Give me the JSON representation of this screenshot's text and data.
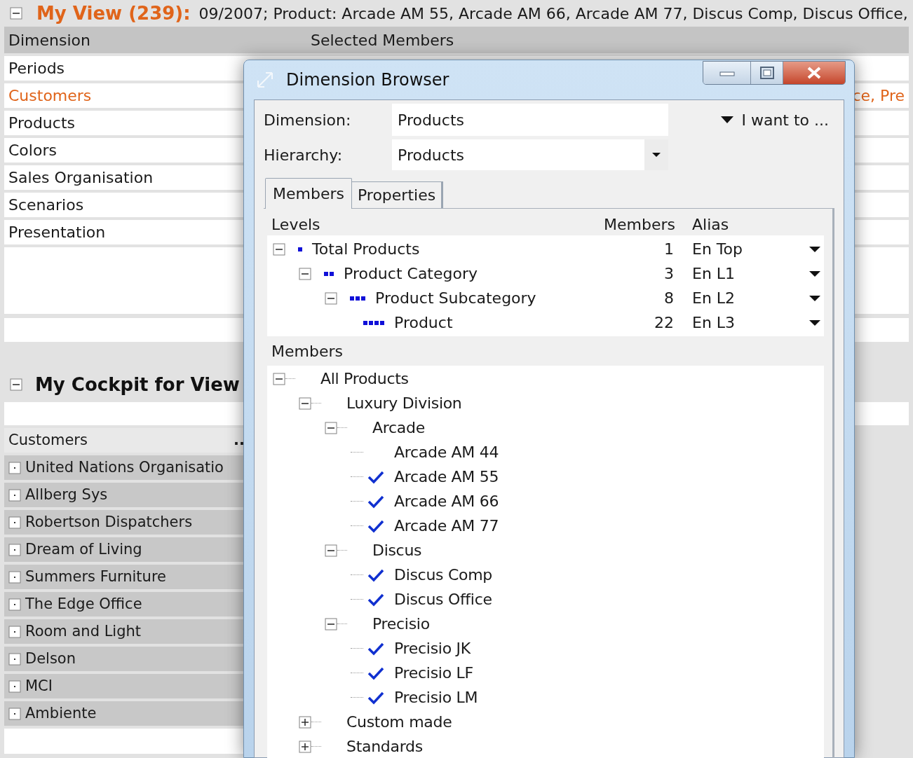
{
  "view": {
    "title": "My View (239):",
    "summary": "09/2007; Product: Arcade AM 55, Arcade AM 66, Arcade AM 77, Discus Comp, Discus Office,",
    "columns": [
      "Dimension",
      "Selected Members"
    ],
    "rows": [
      {
        "label": "Periods",
        "selected": false
      },
      {
        "label": "Customers",
        "selected": true,
        "members": "ce, Pre"
      },
      {
        "label": "Products",
        "selected": false
      },
      {
        "label": "Colors",
        "selected": false
      },
      {
        "label": "Sales Organisation",
        "selected": false
      },
      {
        "label": "Scenarios",
        "selected": false
      },
      {
        "label": "Presentation",
        "selected": false
      }
    ]
  },
  "cockpit": {
    "title": "My Cockpit for View",
    "list_header": "Customers",
    "list_more": "..",
    "items": [
      "United Nations Organisatio",
      "Allberg Sys",
      "Robertson Dispatchers",
      "Dream of Living",
      "Summers Furniture",
      "The Edge Office",
      "Room and Light",
      "Delson",
      "MCI",
      "Ambiente"
    ]
  },
  "dialog": {
    "title": "Dimension Browser",
    "dimension_label": "Dimension:",
    "dimension_value": "Products",
    "hierarchy_label": "Hierarchy:",
    "hierarchy_value": "Products",
    "menu": "I want to ...",
    "tabs": [
      {
        "label": "Members",
        "selected": true
      },
      {
        "label": "Properties",
        "selected": false
      }
    ],
    "levels_header": [
      "Levels",
      "Members",
      "Alias"
    ],
    "levels": [
      {
        "name": "Total Products",
        "count": "1",
        "alias": "En Top",
        "children": [
          {
            "name": "Product Category",
            "count": "3",
            "alias": "En L1",
            "children": [
              {
                "name": "Product Subcategory",
                "count": "8",
                "alias": "En L2",
                "children": [
                  {
                    "name": "Product",
                    "count": "22",
                    "alias": "En L3"
                  }
                ]
              }
            ]
          }
        ]
      }
    ],
    "members_label": "Members",
    "tree": [
      {
        "label": "All Products",
        "kind": "node",
        "expanded": true,
        "children": [
          {
            "label": "Luxury Division",
            "kind": "node",
            "expanded": true,
            "children": [
              {
                "label": "Arcade",
                "kind": "node",
                "expanded": true,
                "children": [
                  {
                    "label": "Arcade AM 44",
                    "kind": "leaf",
                    "checked": false
                  },
                  {
                    "label": "Arcade AM 55",
                    "kind": "leaf",
                    "checked": true
                  },
                  {
                    "label": "Arcade AM 66",
                    "kind": "leaf",
                    "checked": true
                  },
                  {
                    "label": "Arcade AM 77",
                    "kind": "leaf",
                    "checked": true
                  }
                ]
              },
              {
                "label": "Discus",
                "kind": "node",
                "expanded": true,
                "children": [
                  {
                    "label": "Discus Comp",
                    "kind": "leaf",
                    "checked": true
                  },
                  {
                    "label": "Discus Office",
                    "kind": "leaf",
                    "checked": true
                  }
                ]
              },
              {
                "label": "Precisio",
                "kind": "node",
                "expanded": true,
                "children": [
                  {
                    "label": "Precisio JK",
                    "kind": "leaf",
                    "checked": true
                  },
                  {
                    "label": "Precisio LF",
                    "kind": "leaf",
                    "checked": true
                  },
                  {
                    "label": "Precisio LM",
                    "kind": "leaf",
                    "checked": true
                  }
                ]
              }
            ]
          },
          {
            "label": "Custom made",
            "kind": "node",
            "expanded": false
          },
          {
            "label": "Standards",
            "kind": "node",
            "expanded": false
          }
        ]
      }
    ]
  }
}
